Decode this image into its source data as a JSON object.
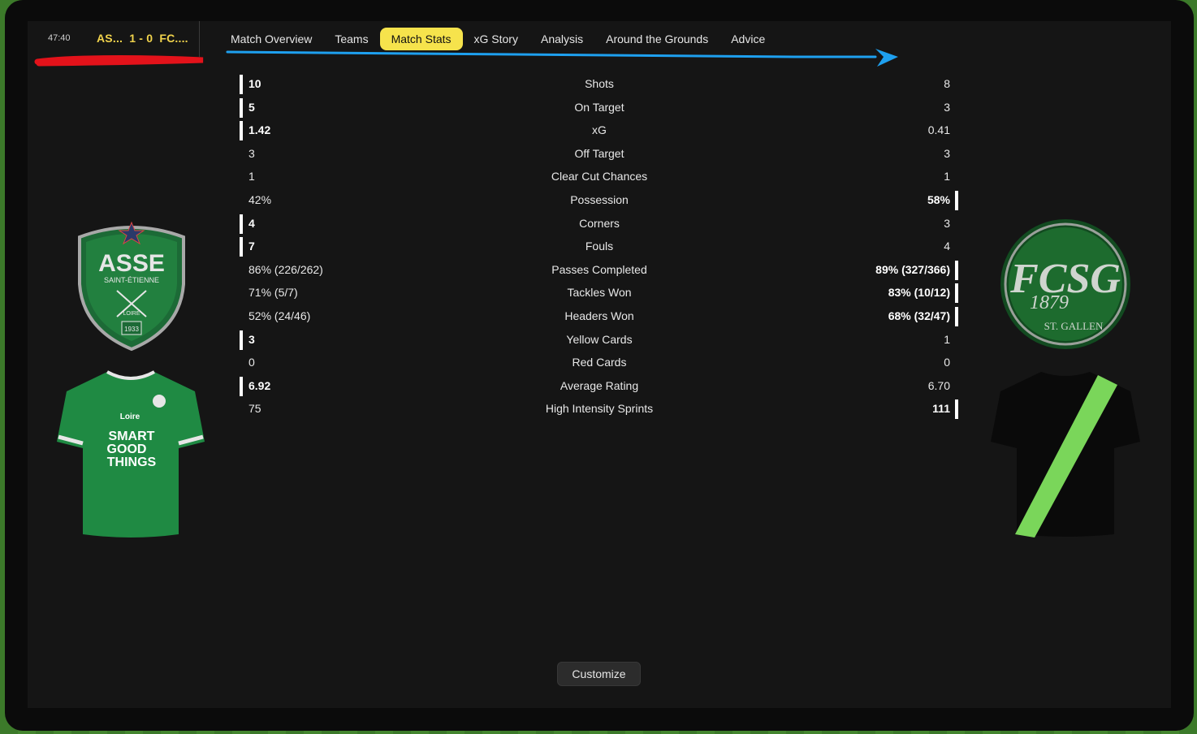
{
  "scoreboard": {
    "clock": "47:40",
    "home": "AS...",
    "score": "1 - 0",
    "away": "FC...."
  },
  "tabs": [
    "Match Overview",
    "Teams",
    "Match Stats",
    "xG Story",
    "Analysis",
    "Around the Grounds",
    "Advice"
  ],
  "active_tab": "Match Stats",
  "stats": [
    {
      "label": "Shots",
      "home": "10",
      "away": "8",
      "leader": "home"
    },
    {
      "label": "On Target",
      "home": "5",
      "away": "3",
      "leader": "home"
    },
    {
      "label": "xG",
      "home": "1.42",
      "away": "0.41",
      "leader": "home"
    },
    {
      "label": "Off Target",
      "home": "3",
      "away": "3",
      "leader": "none"
    },
    {
      "label": "Clear Cut Chances",
      "home": "1",
      "away": "1",
      "leader": "none"
    },
    {
      "label": "Possession",
      "home": "42%",
      "away": "58%",
      "leader": "away"
    },
    {
      "label": "Corners",
      "home": "4",
      "away": "3",
      "leader": "home"
    },
    {
      "label": "Fouls",
      "home": "7",
      "away": "4",
      "leader": "home"
    },
    {
      "label": "Passes Completed",
      "home": "86% (226/262)",
      "away": "89% (327/366)",
      "leader": "away"
    },
    {
      "label": "Tackles Won",
      "home": "71% (5/7)",
      "away": "83% (10/12)",
      "leader": "away"
    },
    {
      "label": "Headers Won",
      "home": "52% (24/46)",
      "away": "68% (32/47)",
      "leader": "away"
    },
    {
      "label": "Yellow Cards",
      "home": "3",
      "away": "1",
      "leader": "home"
    },
    {
      "label": "Red Cards",
      "home": "0",
      "away": "0",
      "leader": "none"
    },
    {
      "label": "Average Rating",
      "home": "6.92",
      "away": "6.70",
      "leader": "home"
    },
    {
      "label": "High Intensity Sprints",
      "home": "75",
      "away": "111",
      "leader": "away"
    }
  ],
  "home_badge": {
    "name": "ASSE",
    "sub": "SAINT-ÉTIENNE",
    "region": "LOIRE",
    "year": "1933"
  },
  "home_shirt": {
    "sponsor_small": "Loire",
    "sponsor": [
      "SMART",
      "GOOD",
      "THINGS"
    ]
  },
  "away_badge": {
    "letters": "FCSG",
    "year": "1879",
    "city": "ST. GALLEN"
  },
  "customize_label": "Customize",
  "colors": {
    "accent": "#f6e34c",
    "score": "#f1d34c",
    "home_green": "#1f8a43",
    "away_stripe": "#7ad65a",
    "annotation_red": "#e3121a",
    "annotation_blue": "#1ea0ef"
  }
}
